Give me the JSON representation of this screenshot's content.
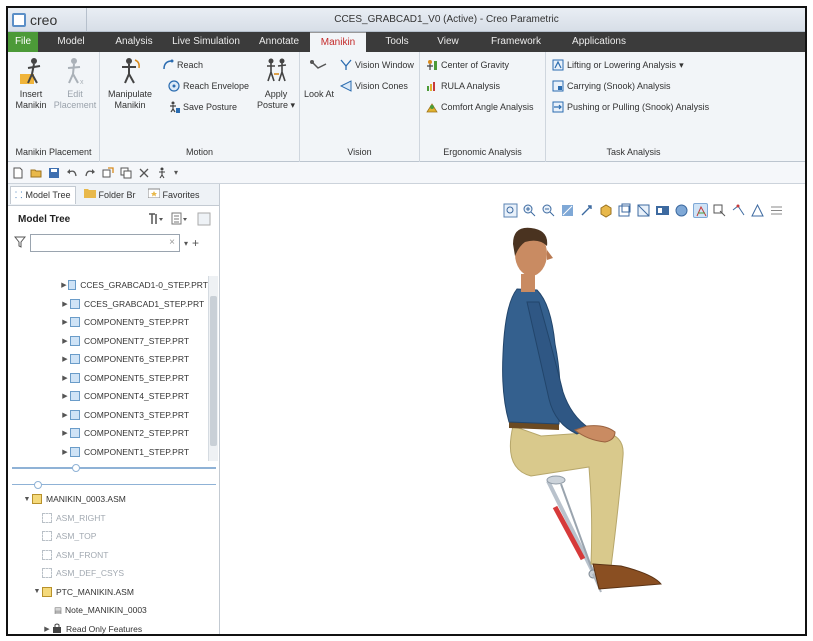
{
  "app": {
    "logo_text": "creo",
    "window_title": "CCES_GRABCAD1_V0 (Active) - Creo Parametric"
  },
  "tabs": [
    {
      "label": "File"
    },
    {
      "label": "Model"
    },
    {
      "label": "Analysis"
    },
    {
      "label": "Live Simulation"
    },
    {
      "label": "Annotate"
    },
    {
      "label": "Manikin"
    },
    {
      "label": "Tools"
    },
    {
      "label": "View"
    },
    {
      "label": "Framework"
    },
    {
      "label": "Applications"
    }
  ],
  "ribbon": {
    "manikin_placement": {
      "group_label": "Manikin Placement",
      "insert_label_1": "Insert",
      "insert_label_2": "Manikin",
      "edit_label_1": "Edit",
      "edit_label_2": "Placement"
    },
    "motion": {
      "group_label": "Motion",
      "manipulate_label_1": "Manipulate",
      "manipulate_label_2": "Manikin",
      "reach": "Reach",
      "reach_envelope": "Reach Envelope",
      "save_posture": "Save Posture",
      "apply_label_1": "Apply",
      "apply_label_2": "Posture"
    },
    "vision": {
      "group_label": "Vision",
      "look_at": "Look At",
      "vision_window": "Vision Window",
      "vision_cones": "Vision Cones"
    },
    "ergonomic": {
      "group_label": "Ergonomic Analysis",
      "center_of_gravity": "Center of Gravity",
      "rula": "RULA Analysis",
      "comfort_angle": "Comfort Angle Analysis"
    },
    "task": {
      "group_label": "Task Analysis",
      "lifting": "Lifting or Lowering Analysis",
      "carrying": "Carrying (Snook) Analysis",
      "pushing": "Pushing or Pulling (Snook) Analysis"
    }
  },
  "left_panel": {
    "tabs": [
      {
        "label": "Model Tree"
      },
      {
        "label": "Folder Br"
      },
      {
        "label": "Favorites"
      }
    ],
    "header": "Model Tree",
    "tree_top": [
      "CCES_GRABCAD1-0_STEP.PRT",
      "CCES_GRABCAD1_STEP.PRT",
      "COMPONENT9_STEP.PRT",
      "COMPONENT7_STEP.PRT",
      "COMPONENT6_STEP.PRT",
      "COMPONENT5_STEP.PRT",
      "COMPONENT4_STEP.PRT",
      "COMPONENT3_STEP.PRT",
      "COMPONENT2_STEP.PRT",
      "COMPONENT1_STEP.PRT"
    ],
    "tree_bottom": {
      "root": "MANIKIN_0003.ASM",
      "planes": [
        "ASM_RIGHT",
        "ASM_TOP",
        "ASM_FRONT",
        "ASM_DEF_CSYS"
      ],
      "sub_asm": "PTC_MANIKIN.ASM",
      "note": "Note_MANIKIN_0003",
      "read_only": "Read Only Features"
    }
  }
}
